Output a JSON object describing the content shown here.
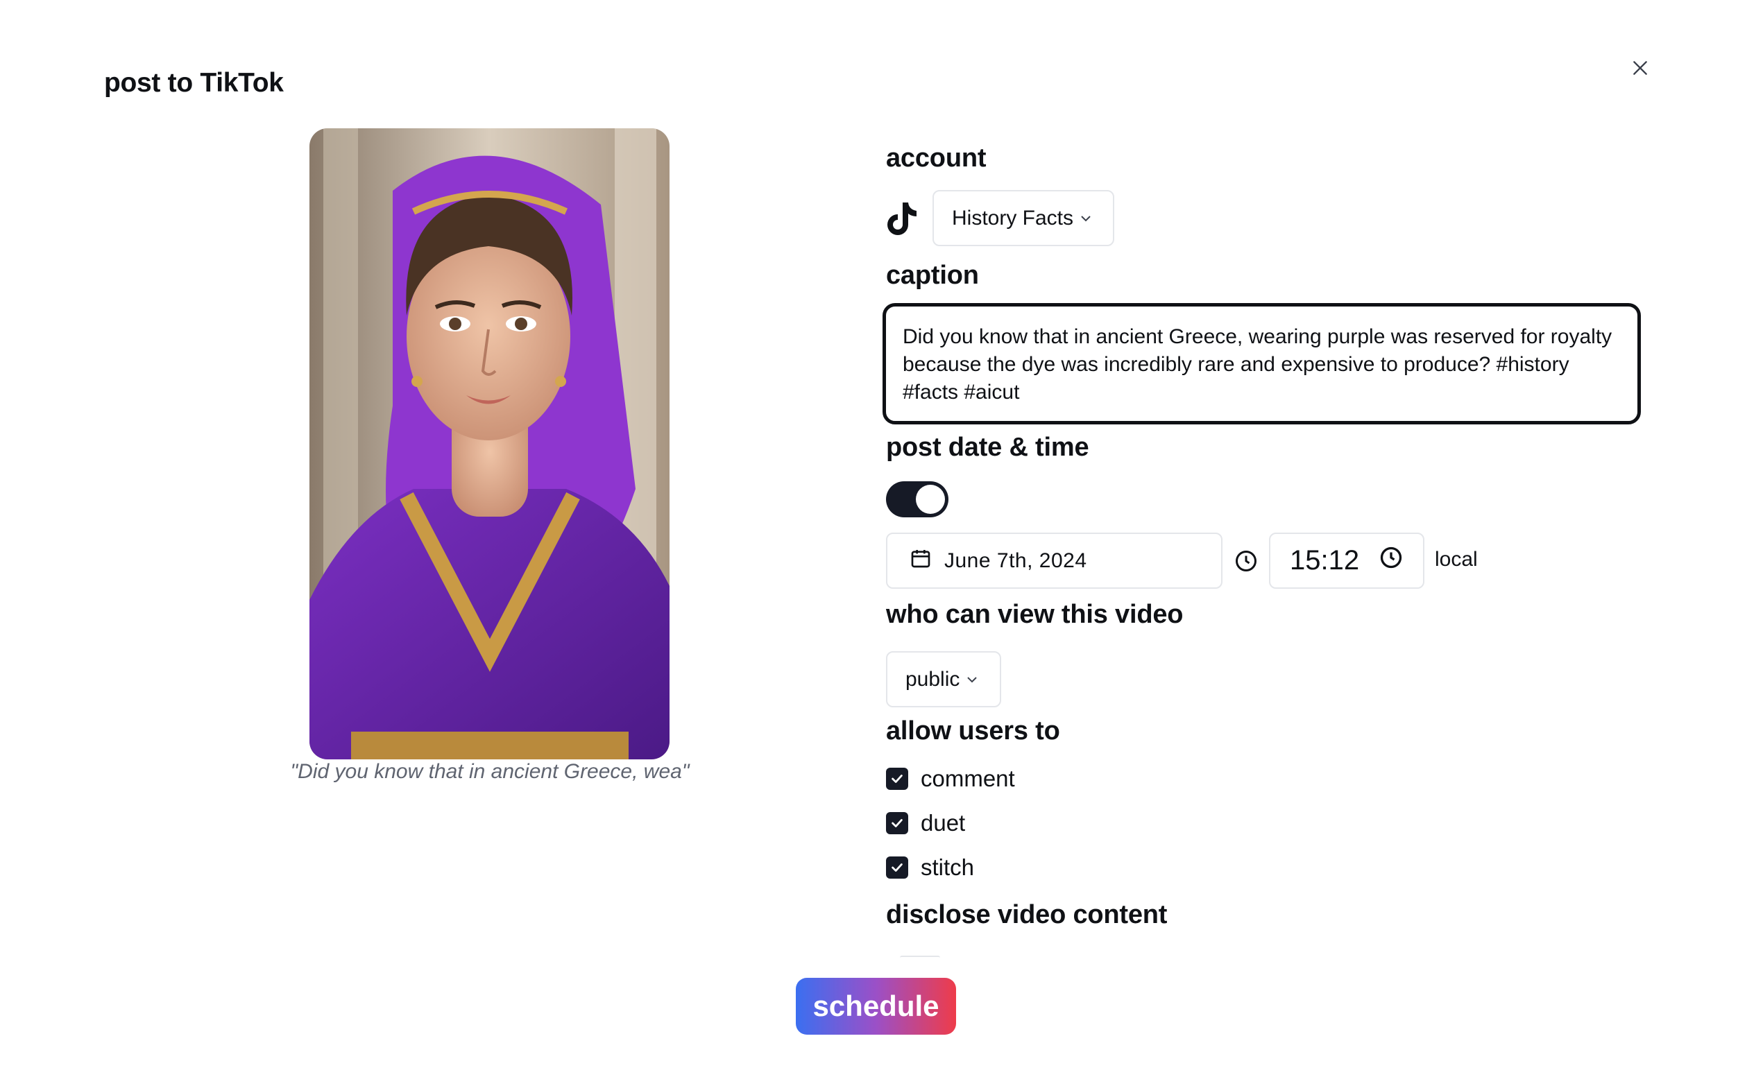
{
  "dialog": {
    "title": "post to TikTok",
    "close_icon": "close-icon"
  },
  "preview": {
    "caption": "\"Did you know that in ancient Greece, wea\""
  },
  "account": {
    "label": "account",
    "platform_icon": "tiktok-icon",
    "selected": "History Facts"
  },
  "caption": {
    "label": "caption",
    "text": "Did you know that in ancient Greece, wearing purple was reserved for royalty because the dye was incredibly rare and expensive to produce? #history #facts #aicut"
  },
  "schedule_time": {
    "label": "post date & time",
    "toggle_on": true,
    "date": "June 7th, 2024",
    "time": "15:12",
    "timezone": "local"
  },
  "visibility": {
    "label": "who can view this video",
    "selected": "public"
  },
  "allow": {
    "label": "allow users to",
    "options": [
      {
        "label": "comment",
        "checked": true
      },
      {
        "label": "duet",
        "checked": true
      },
      {
        "label": "stitch",
        "checked": true
      }
    ]
  },
  "disclose": {
    "label": "disclose video content"
  },
  "actions": {
    "schedule_label": "schedule"
  },
  "colors": {
    "dark": "#161a26",
    "border": "#e4e6ea",
    "gradient_start": "#3b6ff0",
    "gradient_end": "#ee3c4a"
  }
}
